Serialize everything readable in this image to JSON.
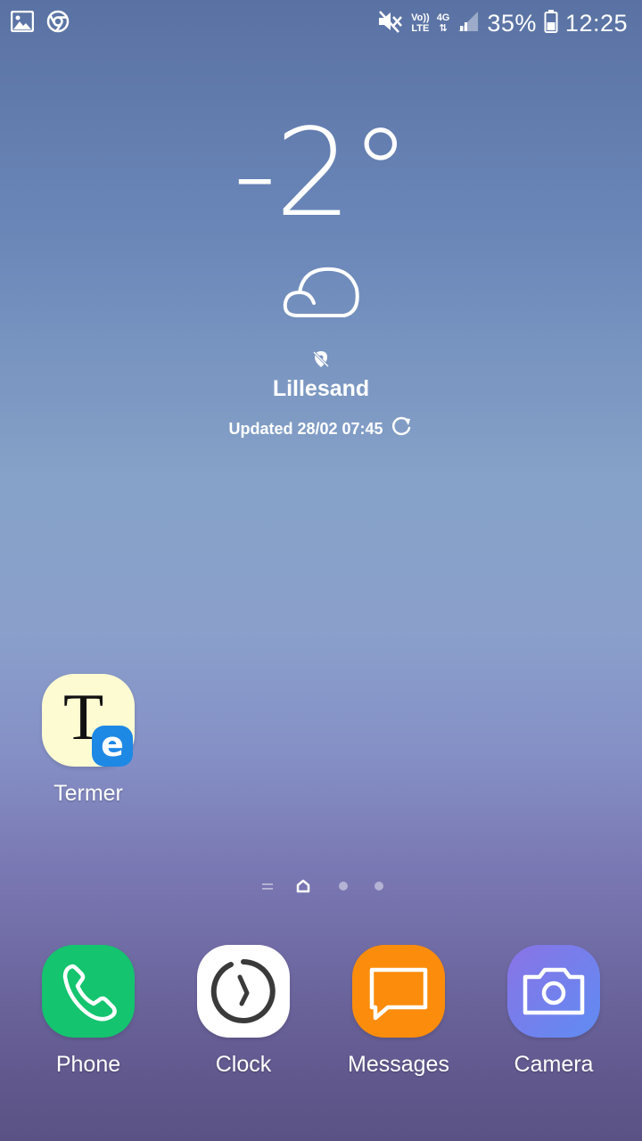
{
  "status_bar": {
    "battery_percent": "35%",
    "time": "12:25",
    "volte_label_top": "Vo))",
    "volte_label_bottom": "LTE",
    "network_label": "4G",
    "icons": [
      "gallery-icon",
      "chrome-icon",
      "mute-icon",
      "volte-icon",
      "4g-data-icon",
      "signal-icon",
      "battery-icon"
    ]
  },
  "weather": {
    "temperature": "-2°",
    "condition_icon": "cloud-icon",
    "location_icon": "location-off-icon",
    "city": "Lillesand",
    "updated": "Updated 28/02 07:45",
    "refresh_icon": "refresh-icon"
  },
  "home_apps": [
    {
      "label": "Termer",
      "icon": "termer-app-icon",
      "color": "#fdfbd2",
      "badge": "e",
      "badge_color": "#1e88e5"
    }
  ],
  "page_indicator": {
    "pages": [
      "menu",
      "home",
      "page-2",
      "page-3"
    ],
    "active": "home"
  },
  "dock": [
    {
      "label": "Phone",
      "icon": "phone-icon",
      "color": "#14c46e"
    },
    {
      "label": "Clock",
      "icon": "clock-icon",
      "color": "#ffffff"
    },
    {
      "label": "Messages",
      "icon": "messages-icon",
      "color": "#fb8c0c"
    },
    {
      "label": "Camera",
      "icon": "camera-icon",
      "color": "#6f7ff0"
    }
  ]
}
